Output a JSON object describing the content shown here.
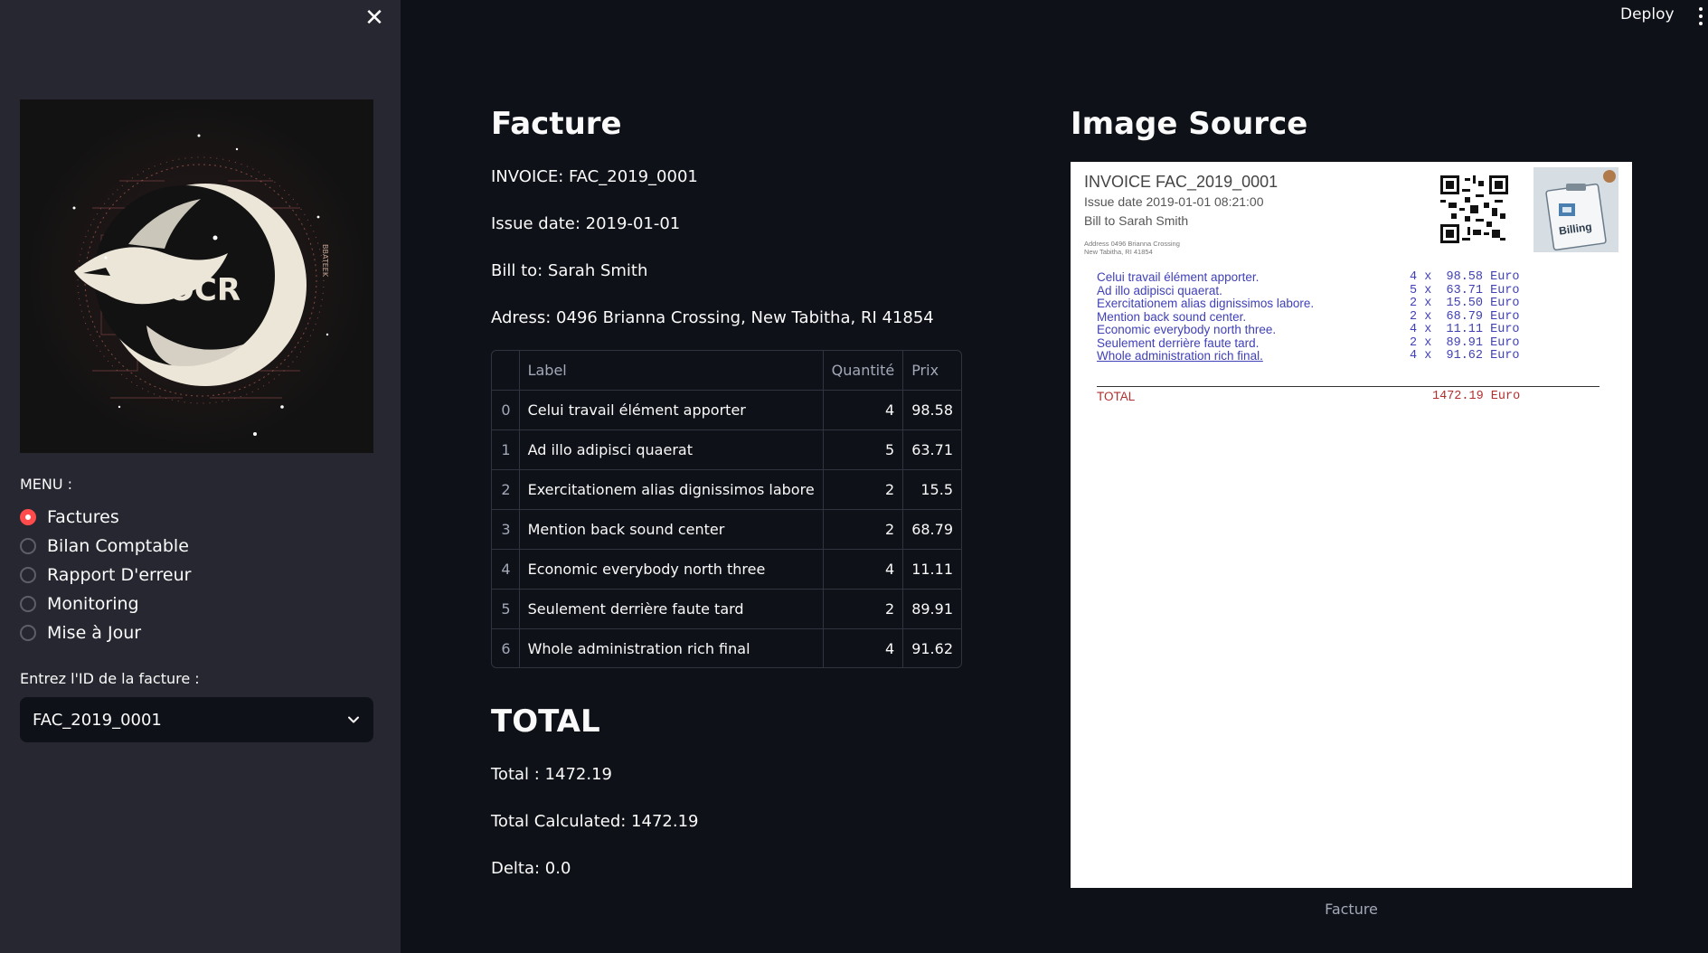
{
  "sidebar": {
    "close_glyph": "✕",
    "logo_text": "OCR",
    "logo_side_text": "BBATEEK",
    "menu_label": "MENU :",
    "menu_items": [
      {
        "label": "Factures",
        "selected": true
      },
      {
        "label": "Bilan Comptable",
        "selected": false
      },
      {
        "label": "Rapport D'erreur",
        "selected": false
      },
      {
        "label": "Monitoring",
        "selected": false
      },
      {
        "label": "Mise à Jour",
        "selected": false
      }
    ],
    "id_label": "Entrez l'ID de la facture :",
    "selected_id": "FAC_2019_0001"
  },
  "header": {
    "deploy_label": "Deploy"
  },
  "facture": {
    "title": "Facture",
    "invoice": "INVOICE: FAC_2019_0001",
    "issue_date": "Issue date: 2019-01-01",
    "bill_to": "Bill to: Sarah Smith",
    "address": "Adress: 0496 Brianna Crossing, New Tabitha, RI 41854",
    "table": {
      "columns": [
        "",
        "Label",
        "Quantité",
        "Prix"
      ],
      "rows": [
        [
          "0",
          "Celui travail élément apporter",
          "4",
          "98.58"
        ],
        [
          "1",
          "Ad illo adipisci quaerat",
          "5",
          "63.71"
        ],
        [
          "2",
          "Exercitationem alias dignissimos labore",
          "2",
          "15.5"
        ],
        [
          "3",
          "Mention back sound center",
          "2",
          "68.79"
        ],
        [
          "4",
          "Economic everybody north three",
          "4",
          "11.11"
        ],
        [
          "5",
          "Seulement derrière faute tard",
          "2",
          "89.91"
        ],
        [
          "6",
          "Whole administration rich final",
          "4",
          "91.62"
        ]
      ]
    }
  },
  "total": {
    "title": "TOTAL",
    "total": "Total : 1472.19",
    "total_calculated": "Total Calculated: 1472.19",
    "delta": "Delta: 0.0"
  },
  "source": {
    "title": "Image Source",
    "caption": "Facture",
    "invoice_image": {
      "title": "INVOICE FAC_2019_0001",
      "issue_date": "Issue date 2019-01-01 08:21:00",
      "bill_to": "Bill to Sarah Smith",
      "address_line1": "Address 0496 Brianna Crossing",
      "address_line2": "New Tabitha, RI 41854",
      "logo_text": "Billing",
      "lines": [
        {
          "label": "Celui travail élément apporter.",
          "qty": "4 x  98.58 Euro"
        },
        {
          "label": "Ad illo adipisci quaerat.",
          "qty": "5 x  63.71 Euro"
        },
        {
          "label": "Exercitationem alias dignissimos labore.",
          "qty": "2 x  15.50 Euro"
        },
        {
          "label": "Mention back sound center.",
          "qty": "2 x  68.79 Euro"
        },
        {
          "label": "Economic everybody north three.",
          "qty": "4 x  11.11 Euro"
        },
        {
          "label": "Seulement derrière faute tard.",
          "qty": "2 x  89.91 Euro"
        },
        {
          "label": "Whole administration rich final.",
          "qty": "4 x  91.62 Euro"
        }
      ],
      "total_label": "TOTAL",
      "total_value": "1472.19 Euro"
    }
  },
  "colors": {
    "app_bg": "#0e1117",
    "sidebar_bg": "#262730",
    "accent": "#ff4b4b",
    "invoice_text_blue": "#4040b8",
    "invoice_total_red": "#b03030"
  }
}
